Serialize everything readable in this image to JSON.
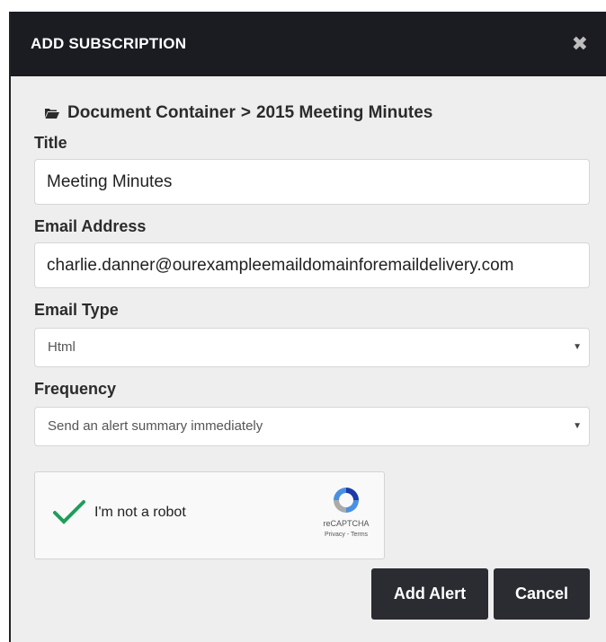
{
  "dialog": {
    "title": "ADD SUBSCRIPTION",
    "close_icon": "close-icon"
  },
  "breadcrumb": {
    "icon": "folder-open-icon",
    "parent": "Document Container",
    "separator": ">",
    "current": "2015 Meeting Minutes"
  },
  "form": {
    "title_label": "Title",
    "title_value": "Meeting Minutes",
    "email_label": "Email Address",
    "email_value": "charlie.danner@ourexampleemaildomainforemaildelivery.com",
    "email_type_label": "Email Type",
    "email_type_value": "Html",
    "frequency_label": "Frequency",
    "frequency_value": "Send an alert summary immediately"
  },
  "recaptcha": {
    "checkbox_label": "I'm not a robot",
    "brand": "reCAPTCHA",
    "links": "Privacy - Terms",
    "checked": true
  },
  "actions": {
    "add_label": "Add Alert",
    "cancel_label": "Cancel"
  },
  "colors": {
    "header_bg": "#1a1c22",
    "dialog_bg": "#eeeeee",
    "button_bg": "#2a2c31",
    "check_green": "#1e9e5a"
  }
}
